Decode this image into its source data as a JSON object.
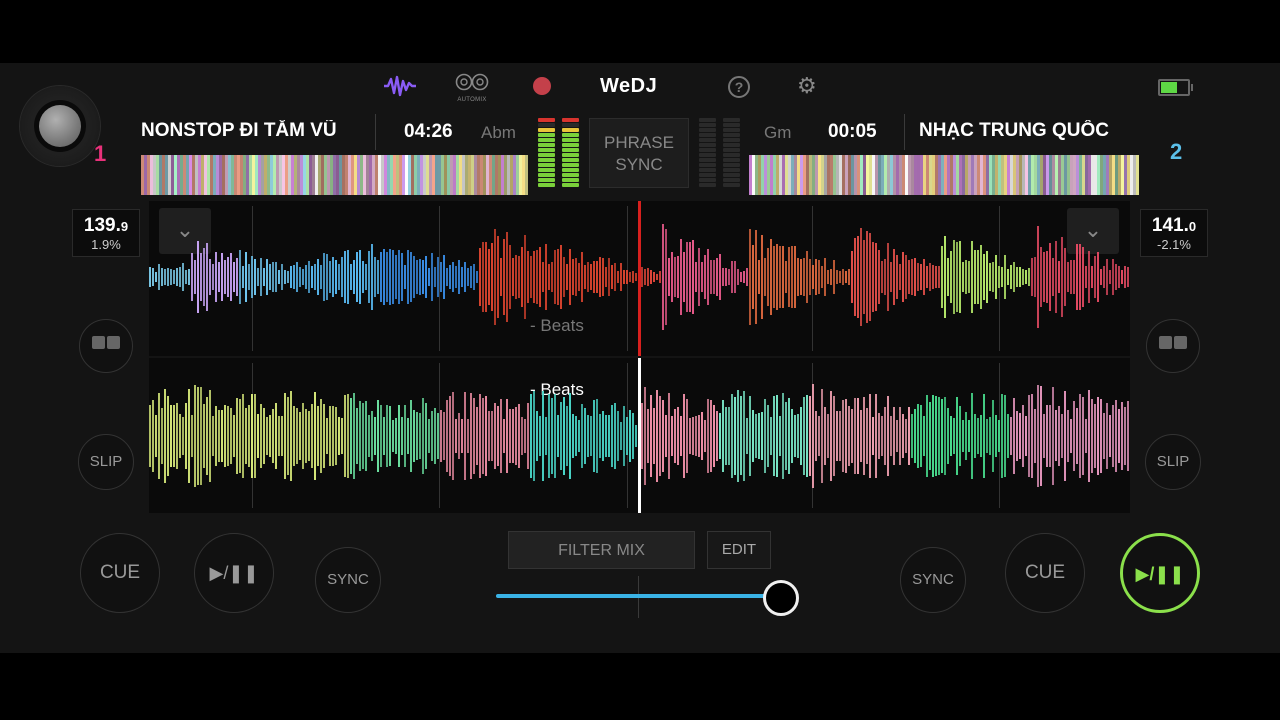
{
  "app": {
    "name": "WeDJ",
    "automix_label": "AUTOMIX"
  },
  "colors": {
    "deck1": "#e8317a",
    "deck2": "#5bbfe8",
    "play_active": "#8be04b",
    "slider": "#3ab3e6",
    "playhead_top": "#d8201e"
  },
  "deck1": {
    "number": "1",
    "title": "NONSTOP ĐI TẮM  VŨ",
    "time": "04:26",
    "key": "Abm",
    "bpm_int": "139.",
    "bpm_dec": "9",
    "pitch": "1.9%",
    "beats_label": "- Beats",
    "cue": "CUE",
    "play": "▶/❚❚",
    "sync": "SYNC",
    "slip": "SLIP"
  },
  "deck2": {
    "number": "2",
    "title": "NHẠC TRUNG QUỐC",
    "time": "00:05",
    "key": "Gm",
    "bpm_int": "141.",
    "bpm_dec": "0",
    "pitch": "-2.1%",
    "beats_label": "- Beats",
    "cue": "CUE",
    "play": "▶/❚❚",
    "sync": "SYNC",
    "slip": "SLIP"
  },
  "center": {
    "phrase_sync_line1": "PHRASE",
    "phrase_sync_line2": "SYNC",
    "filter_mix": "FILTER MIX",
    "edit": "EDIT",
    "crossfader": 0.95
  },
  "battery_level": 0.6,
  "icons": {
    "waveform": "waveform-icon",
    "automix": "automix-icon",
    "record": "record-icon",
    "help": "help-icon",
    "settings": "gear-icon",
    "battery": "battery-icon",
    "chevron": "chevron-down-icon",
    "loop": "loop-icon"
  }
}
